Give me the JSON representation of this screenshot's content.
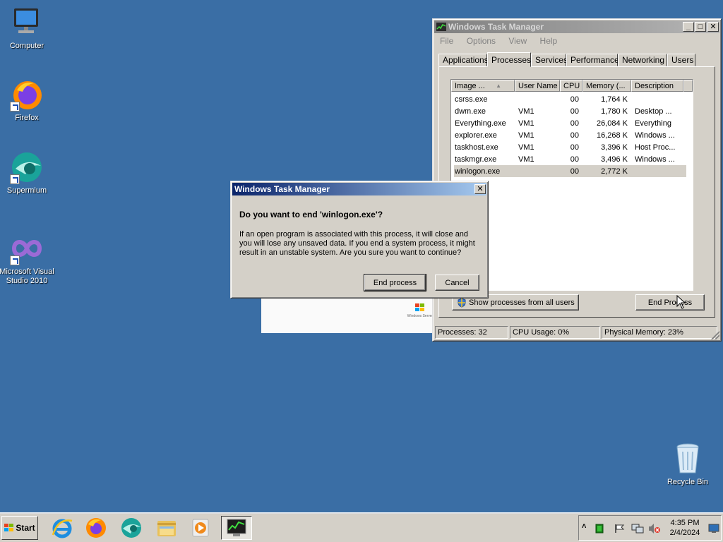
{
  "desktop": {
    "icons": [
      {
        "label": "Computer"
      },
      {
        "label": "Firefox"
      },
      {
        "label": "Supermium"
      },
      {
        "label": "Microsoft Visual Studio 2010"
      },
      {
        "label": "Recycle Bin"
      }
    ]
  },
  "taskmgr": {
    "title": "Windows Task Manager",
    "menu": [
      "File",
      "Options",
      "View",
      "Help"
    ],
    "tabs": [
      "Applications",
      "Processes",
      "Services",
      "Performance",
      "Networking",
      "Users"
    ],
    "selected_tab": "Processes",
    "columns": [
      "Image ...",
      "User Name",
      "CPU",
      "Memory (...",
      "Description"
    ],
    "rows": [
      {
        "image": "csrss.exe",
        "user": "",
        "cpu": "00",
        "memory": "1,764 K",
        "desc": ""
      },
      {
        "image": "dwm.exe",
        "user": "VM1",
        "cpu": "00",
        "memory": "1,780 K",
        "desc": "Desktop ..."
      },
      {
        "image": "Everything.exe",
        "user": "VM1",
        "cpu": "00",
        "memory": "26,084 K",
        "desc": "Everything"
      },
      {
        "image": "explorer.exe",
        "user": "VM1",
        "cpu": "00",
        "memory": "16,268 K",
        "desc": "Windows ..."
      },
      {
        "image": "taskhost.exe",
        "user": "VM1",
        "cpu": "00",
        "memory": "3,396 K",
        "desc": "Host Proc..."
      },
      {
        "image": "taskmgr.exe",
        "user": "VM1",
        "cpu": "00",
        "memory": "3,496 K",
        "desc": "Windows ..."
      },
      {
        "image": "winlogon.exe",
        "user": "",
        "cpu": "00",
        "memory": "2,772 K",
        "desc": ""
      }
    ],
    "selected_row": "winlogon.exe",
    "show_all_label": "Show processes from all users",
    "end_process_label": "End Process",
    "status": {
      "processes": "Processes: 32",
      "cpu": "CPU Usage: 0%",
      "memory": "Physical Memory: 23%"
    }
  },
  "dialog": {
    "title": "Windows Task Manager",
    "question": "Do you want to end 'winlogon.exe'?",
    "body": "If an open program is associated with this process, it will close and you will lose any unsaved data. If you end a system process, it might result in an unstable system. Are you sure you want to continue?",
    "confirm_label": "End process",
    "cancel_label": "Cancel"
  },
  "background_window": {
    "brand_text": "Windows Server"
  },
  "taskbar": {
    "start_label": "Start",
    "apps": [
      "internet-explorer-icon",
      "firefox-icon",
      "supermium-icon",
      "file-explorer-icon",
      "media-player-icon",
      "task-manager-icon"
    ],
    "clock_time": "4:35 PM",
    "clock_date": "2/4/2024"
  },
  "colors": {
    "desktop": "#3a6ea5",
    "active_title": "#0a246a",
    "face": "#d4d0c8"
  }
}
